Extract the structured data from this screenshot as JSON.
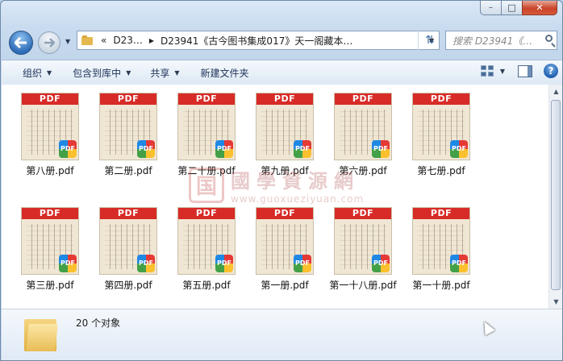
{
  "window": {
    "minimize": "–",
    "maximize": "□",
    "close": "✕"
  },
  "address": {
    "history_prefix": "«",
    "crumb_short": "D23…",
    "crumb_folder": "D23941《古今图书集成017》天一阁藏本…",
    "separator": "▶",
    "dropdown": "▼",
    "refresh": "⇅"
  },
  "search": {
    "placeholder": "搜索 D23941《…"
  },
  "toolbar": {
    "organize": "组织",
    "include_in_library": "包含到库中",
    "share": "共享",
    "new_folder": "新建文件夹",
    "arrow": "▼",
    "help": "?"
  },
  "files": [
    {
      "name": "第八册.pdf",
      "band": "PDF",
      "badge": "PDF"
    },
    {
      "name": "第二册.pdf",
      "band": "PDF",
      "badge": "PDF"
    },
    {
      "name": "第二十册.pdf",
      "band": "PDF",
      "badge": "PDF"
    },
    {
      "name": "第九册.pdf",
      "band": "PDF",
      "badge": "PDF"
    },
    {
      "name": "第六册.pdf",
      "band": "PDF",
      "badge": "PDF"
    },
    {
      "name": "第七册.pdf",
      "band": "PDF",
      "badge": "PDF"
    },
    {
      "name": "第三册.pdf",
      "band": "PDF",
      "badge": "PDF"
    },
    {
      "name": "第四册.pdf",
      "band": "PDF",
      "badge": "PDF"
    },
    {
      "name": "第五册.pdf",
      "band": "PDF",
      "badge": "PDF"
    },
    {
      "name": "第一册.pdf",
      "band": "PDF",
      "badge": "PDF"
    },
    {
      "name": "第一十八册.pdf",
      "band": "PDF",
      "badge": "PDF"
    },
    {
      "name": "第一十册.pdf",
      "band": "PDF",
      "badge": "PDF"
    }
  ],
  "watermark": {
    "seal": "国",
    "title": "國學資源網",
    "url": "www.guoxueziyuan.com"
  },
  "status": {
    "count": "20 个对象"
  },
  "colors": {
    "pdf_red": "#d72b27",
    "toolbar_text": "#1e3358"
  }
}
